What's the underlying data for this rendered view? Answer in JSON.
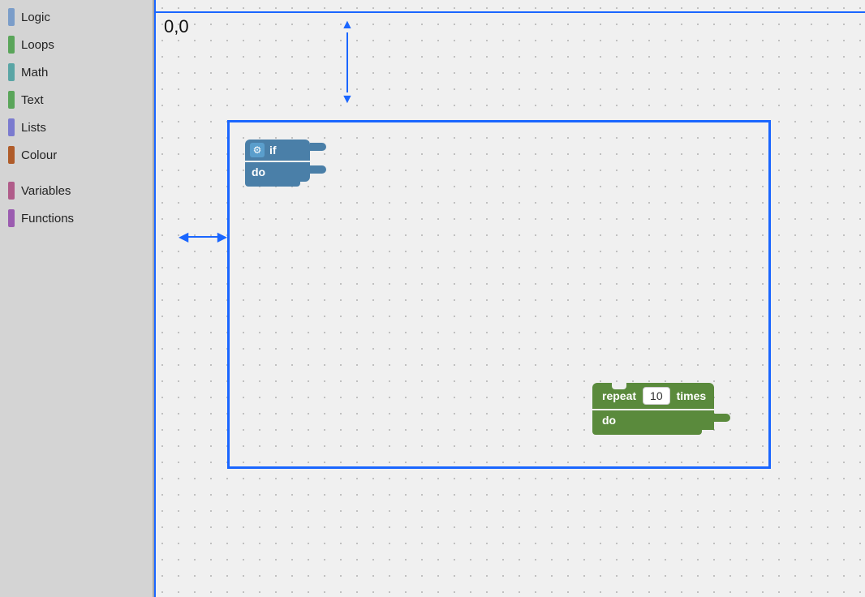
{
  "sidebar": {
    "items": [
      {
        "label": "Logic",
        "color": "#7b9dc9"
      },
      {
        "label": "Loops",
        "color": "#5aa55a"
      },
      {
        "label": "Math",
        "color": "#5aa5a5"
      },
      {
        "label": "Text",
        "color": "#5aa55a"
      },
      {
        "label": "Lists",
        "color": "#7b7bcf"
      },
      {
        "label": "Colour",
        "color": "#b05c2a"
      },
      {
        "label": "Variables",
        "color": "#b05c8a"
      },
      {
        "label": "Functions",
        "color": "#9b5cb0"
      }
    ]
  },
  "canvas": {
    "coord_label": "0,0",
    "repeat_value": "10",
    "if_label": "if",
    "do_label": "do",
    "repeat_label": "repeat",
    "times_label": "times"
  }
}
